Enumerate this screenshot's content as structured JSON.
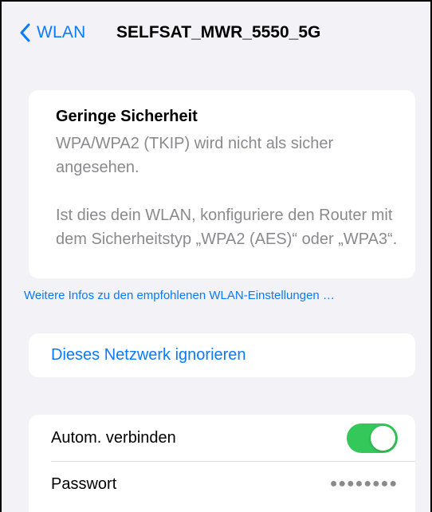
{
  "nav": {
    "back_label": "WLAN",
    "title": "SELFSAT_MWR_5550_5G"
  },
  "security_warning": {
    "title": "Geringe Sicherheit",
    "line1": "WPA/WPA2 (TKIP) wird nicht als sicher angesehen.",
    "line2": "Ist dies dein WLAN, konfiguriere den Router mit dem Sicherheitstyp „WPA2 (AES)“ oder „WPA3“."
  },
  "more_info_link": "Weitere Infos zu den empfohlenen WLAN-Einstellungen …",
  "ignore_network_label": "Dieses Netzwerk ignorieren",
  "settings": {
    "auto_join_label": "Autom. verbinden",
    "auto_join_enabled": true,
    "password_label": "Passwort",
    "password_masked": "●●●●●●●●"
  },
  "colors": {
    "accent": "#0a7aff",
    "toggle_on": "#34c759",
    "background": "#f2f2f7",
    "secondary_text": "#8a8a8e"
  }
}
